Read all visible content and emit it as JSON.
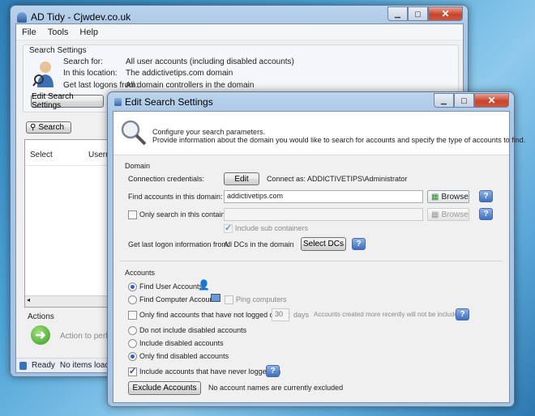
{
  "main": {
    "title": "AD Tidy - Cjwdev.co.uk",
    "menu": [
      "File",
      "Tools",
      "Help"
    ],
    "search_settings": {
      "header": "Search Settings",
      "rows": [
        {
          "label": "Search for:",
          "value": "All user accounts (including disabled accounts)"
        },
        {
          "label": "In this location:",
          "value": "The addictivetips.com domain"
        },
        {
          "label": "Get last logons from:",
          "value": "All domain controllers in the domain"
        }
      ],
      "edit_button": "Edit Search Settings"
    },
    "search_button": "Search",
    "columns": [
      "Select",
      "Usernam"
    ],
    "actions_header": "Actions",
    "action_text": "Action to perform o",
    "status": "Ready",
    "status_items": "No items loaded"
  },
  "dialog": {
    "title": "Edit Search Settings",
    "intro_line1": "Configure your search parameters.",
    "intro_line2": "Provide information about the domain you would like to search for accounts and specify the type of accounts to find.",
    "domain": {
      "header": "Domain",
      "credentials_label": "Connection credentials:",
      "edit_button": "Edit",
      "connect_as": "Connect as: ADDICTIVETIPS\\Administrator",
      "find_label": "Find accounts in this domain:",
      "domain_value": "addictivetips.com",
      "browse": "Browse",
      "container_label": "Only search in this container:",
      "container_value": "",
      "include_sub": "Include sub containers",
      "logon_label": "Get last logon information from:",
      "logon_value": "All DCs in the domain",
      "select_dcs": "Select DCs"
    },
    "accounts": {
      "header": "Accounts",
      "find_user": "Find User Accounts",
      "find_computer": "Find Computer Accounts",
      "ping": "Ping computers",
      "not_logged_label": "Only find accounts that have not logged on for:",
      "days_value": "30",
      "days_unit": "days",
      "days_note": "Accounts created more recently will not be included",
      "no_disabled": "Do not include disabled accounts",
      "include_disabled": "Include disabled accounts",
      "only_disabled": "Only find disabled accounts",
      "never_logged": "Include accounts that have never logged on",
      "exclude_button": "Exclude Accounts",
      "exclude_note": "No account names are currently excluded"
    },
    "help": "?"
  }
}
